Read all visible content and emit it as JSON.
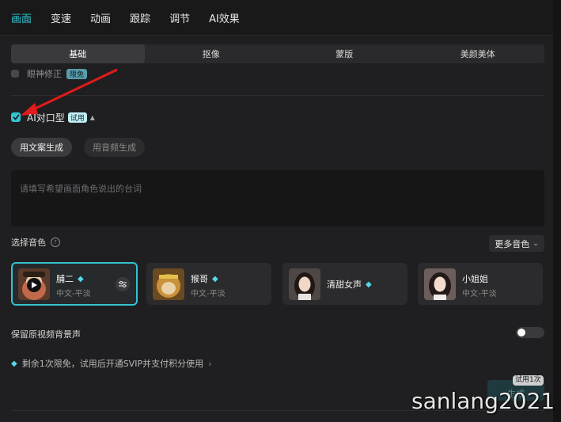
{
  "top_tabs": [
    "画面",
    "变速",
    "动画",
    "跟踪",
    "调节",
    "AI效果"
  ],
  "sub_tabs": [
    "基础",
    "抠像",
    "蒙版",
    "美颜美体"
  ],
  "cut_option": {
    "label": "眼神修正",
    "badge": "限免"
  },
  "ai_lipsync": {
    "label": "AI对口型",
    "trial_badge": "试用",
    "checked": true
  },
  "gen_mode": {
    "text_mode": "用文案生成",
    "audio_mode": "用音频生成"
  },
  "script_input": {
    "placeholder": "请填写希望画面角色说出的台词",
    "value": ""
  },
  "voice_section": {
    "label": "选择音色",
    "more_label": "更多音色"
  },
  "voices": [
    {
      "name": "脯二",
      "lang": "中文-平淡",
      "premium": true
    },
    {
      "name": "猴哥",
      "lang": "中文-平淡",
      "premium": true
    },
    {
      "name": "清甜女声",
      "lang": "",
      "premium": true
    },
    {
      "name": "小姐姐",
      "lang": "中文-平淡",
      "premium": false
    }
  ],
  "keep_bg_sound": {
    "label": "保留原视频背景声",
    "on": false
  },
  "promo": {
    "text": "剩余1次限免，试用后开通SVIP并支付积分使用"
  },
  "generate": {
    "label": "生成",
    "trial_count": "试用1次"
  },
  "watermark": "sanlang2021",
  "colors": {
    "accent": "#2fc7d1",
    "bg": "#1f1f21",
    "gem": "#58d7ea"
  }
}
